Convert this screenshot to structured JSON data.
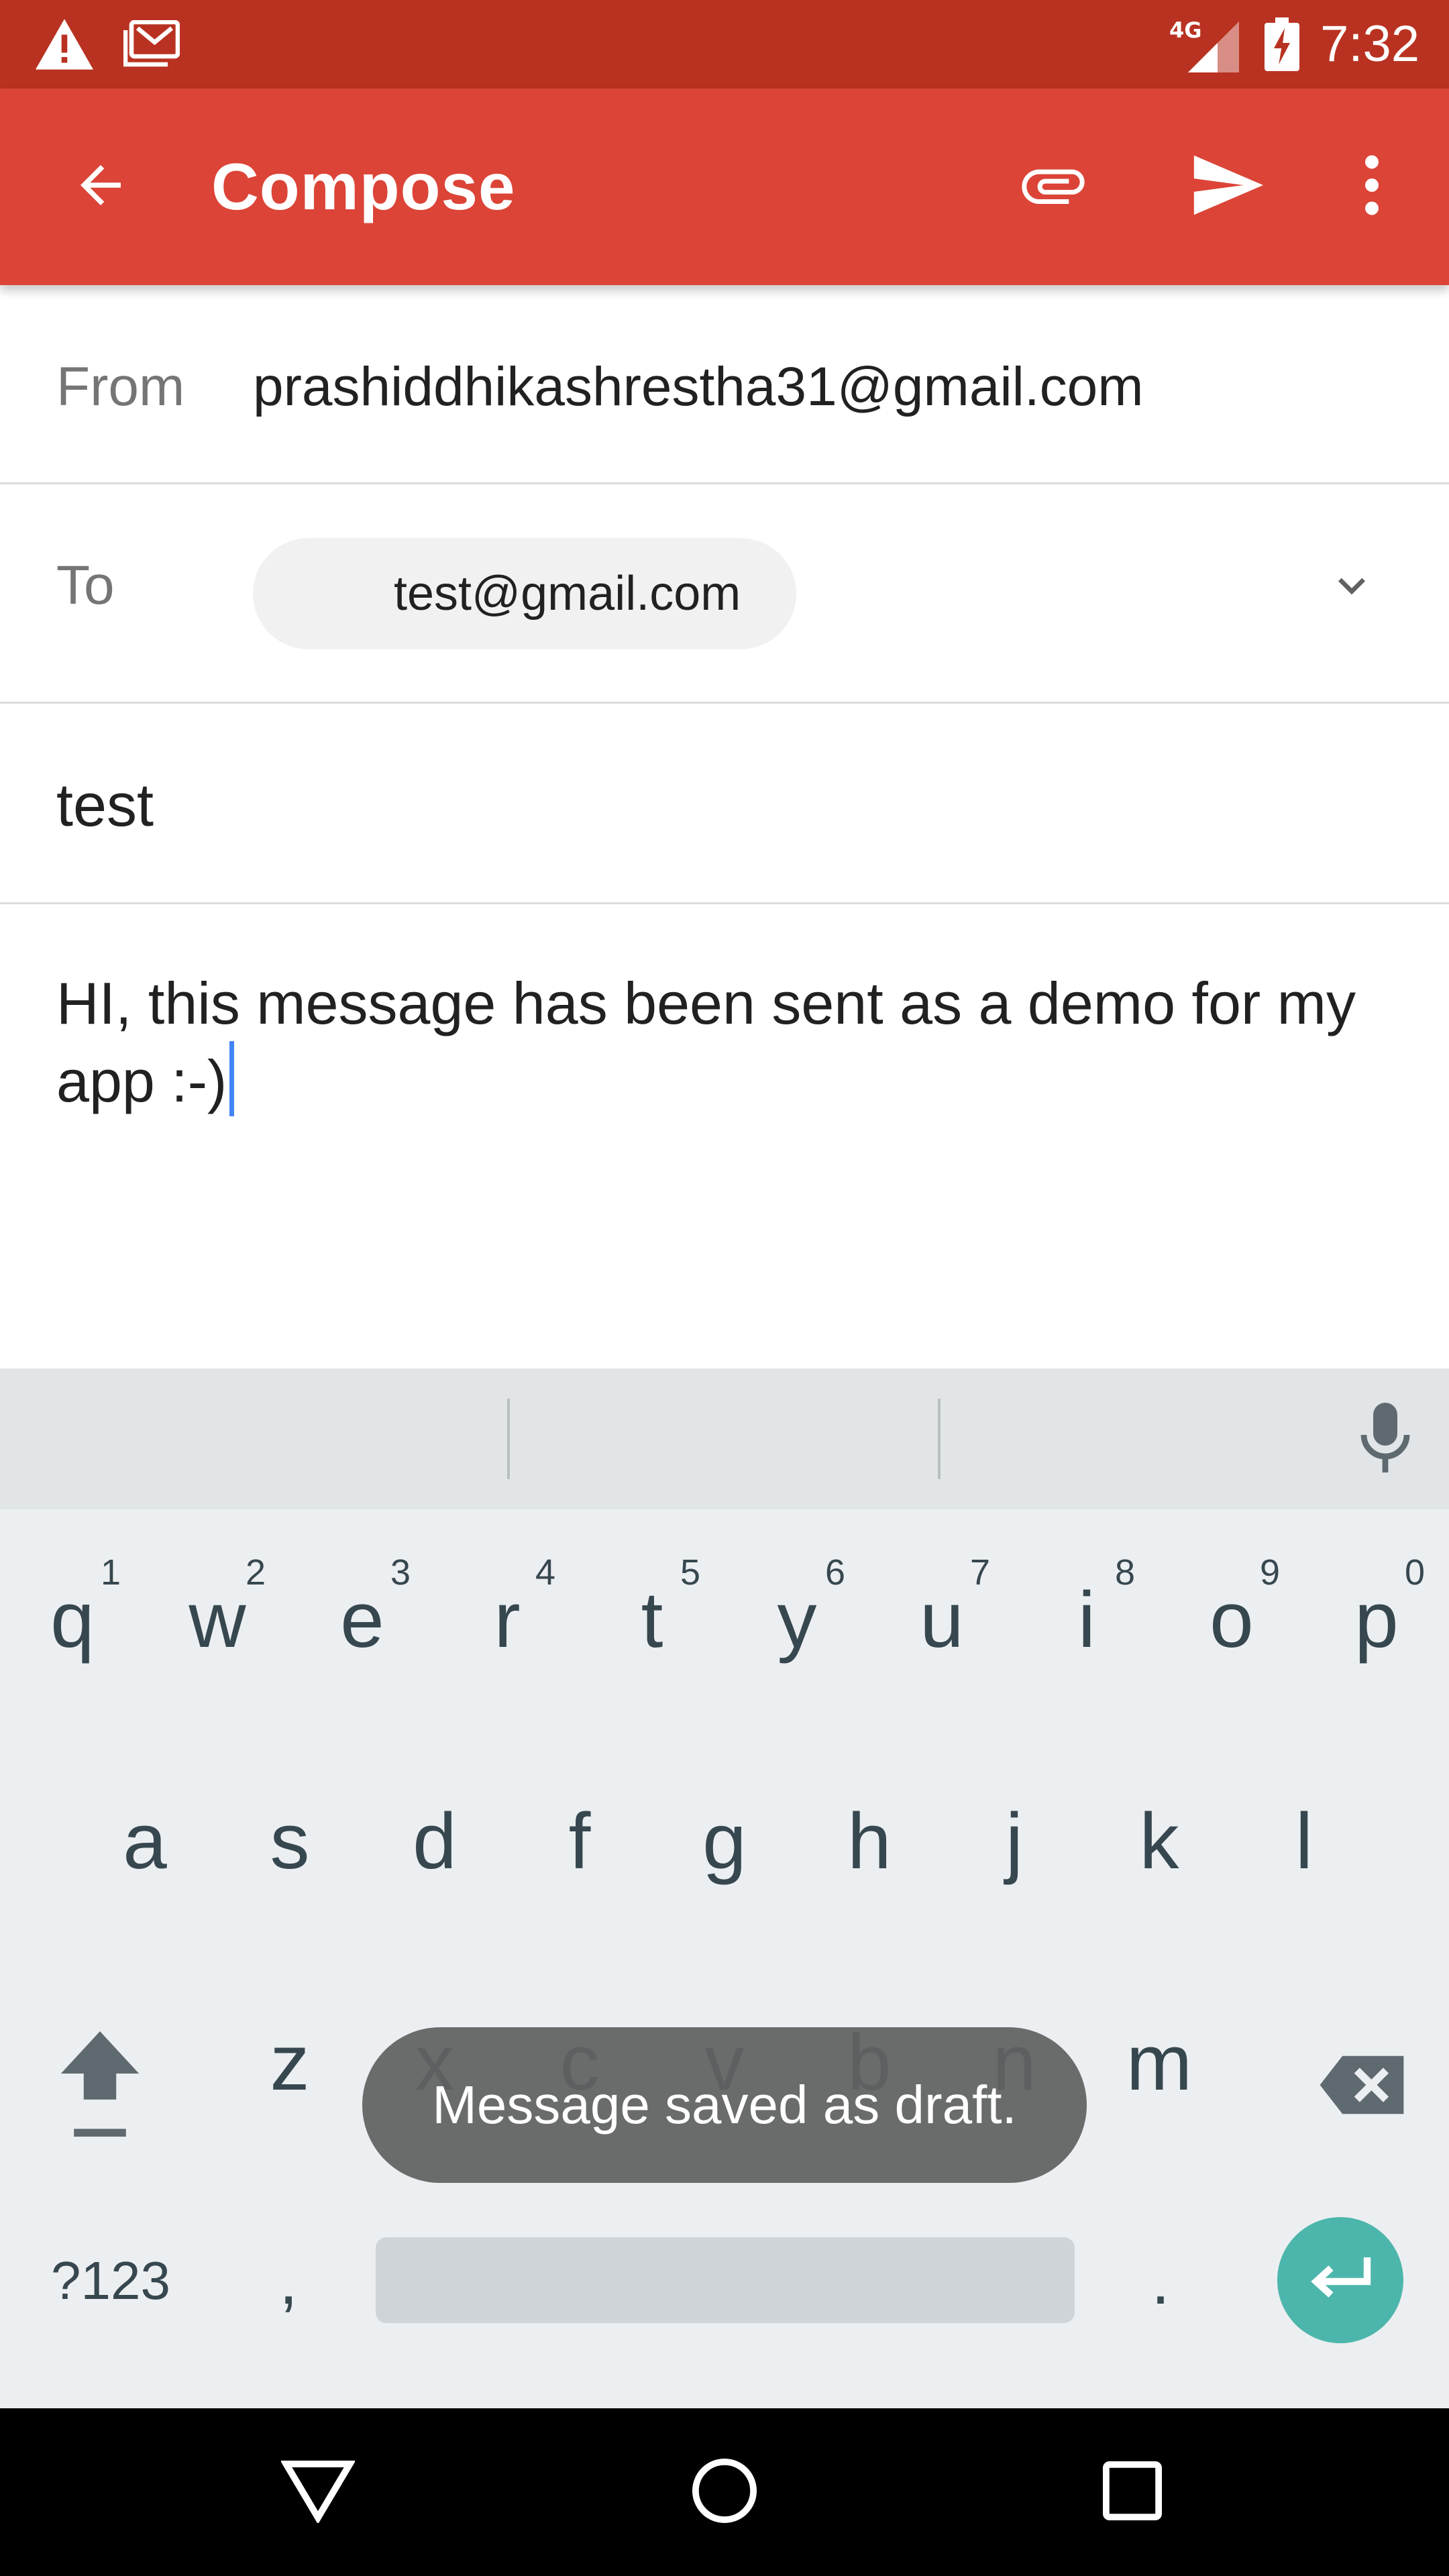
{
  "status_bar": {
    "time": "7:32",
    "network": "4G",
    "icons": [
      "warning-icon",
      "gmail-notification-icon",
      "signal-icon",
      "battery-charging-icon"
    ]
  },
  "app_bar": {
    "title": "Compose",
    "icons": [
      "back-arrow-icon",
      "attach-icon",
      "send-icon",
      "more-vert-icon"
    ]
  },
  "compose": {
    "from_label": "From",
    "from_value": "prashiddhikashrestha31@gmail.com",
    "to_label": "To",
    "to_chip": "test@gmail.com",
    "subject": "test",
    "body": "HI, this message has been sent as a demo for my app :-)"
  },
  "keyboard": {
    "row1": [
      {
        "key": "q",
        "hint": "1"
      },
      {
        "key": "w",
        "hint": "2"
      },
      {
        "key": "e",
        "hint": "3"
      },
      {
        "key": "r",
        "hint": "4"
      },
      {
        "key": "t",
        "hint": "5"
      },
      {
        "key": "y",
        "hint": "6"
      },
      {
        "key": "u",
        "hint": "7"
      },
      {
        "key": "i",
        "hint": "8"
      },
      {
        "key": "o",
        "hint": "9"
      },
      {
        "key": "p",
        "hint": "0"
      }
    ],
    "row2": [
      "a",
      "s",
      "d",
      "f",
      "g",
      "h",
      "j",
      "k",
      "l"
    ],
    "row3": [
      "z",
      "x",
      "c",
      "v",
      "b",
      "n",
      "m"
    ],
    "symbols_label": "?123",
    "comma": ",",
    "period": "."
  },
  "toast": "Message saved as draft.",
  "colors": {
    "status_bar": "#b93221",
    "app_bar": "#db4437",
    "enter_key": "#4db6ac",
    "cursor": "#4285f4"
  },
  "nav_bar": {
    "icons": [
      "back-triangle-icon",
      "home-circle-icon",
      "recents-square-icon"
    ]
  }
}
